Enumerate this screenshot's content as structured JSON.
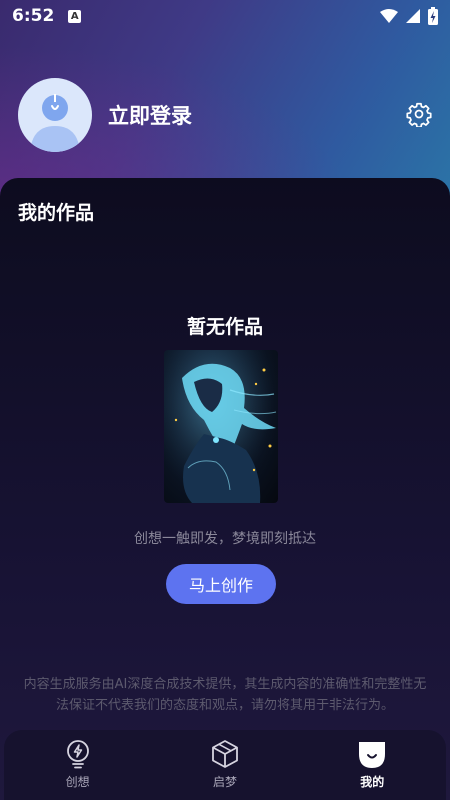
{
  "status_bar": {
    "time": "6:52",
    "notification_letter": "A"
  },
  "profile": {
    "login_label": "立即登录"
  },
  "works": {
    "section_title": "我的作品",
    "empty_title": "暂无作品",
    "tagline": "创想一触即发，梦境即刻抵达",
    "create_button": "马上创作",
    "disclaimer": "内容生成服务由AI深度合成技术提供，其生成内容的准确性和完整性无法保证不代表我们的态度和观点，请勿将其用于非法行为。"
  },
  "bottom_nav": {
    "items": [
      {
        "label": "创想",
        "icon": "lightbulb-icon",
        "active": false
      },
      {
        "label": "启梦",
        "icon": "cube-icon",
        "active": false
      },
      {
        "label": "我的",
        "icon": "profile-face-icon",
        "active": true
      }
    ]
  },
  "colors": {
    "accent": "#5d73f0",
    "panel": "#0d0c1f",
    "nav_bg": "#16122e"
  }
}
